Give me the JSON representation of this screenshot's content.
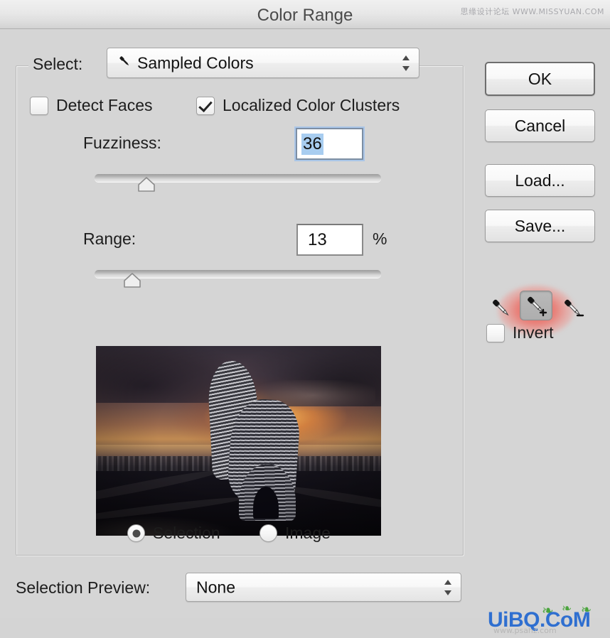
{
  "window": {
    "title": "Color Range"
  },
  "watermarks": {
    "top": "思缘设计论坛 WWW.MISSYUAN.COM",
    "bottom_logo": "UiBQ.CoM",
    "bottom_sub": "www.psahz.com"
  },
  "form": {
    "select_label": "Select:",
    "select_value": "Sampled Colors",
    "select_icon": "eyedropper-icon",
    "detect_faces": {
      "label": "Detect Faces",
      "checked": false
    },
    "localized_color_clusters": {
      "label": "Localized Color Clusters",
      "checked": true
    },
    "fuzziness": {
      "label": "Fuzziness:",
      "value": "36",
      "selected": true,
      "slider_percent": 18
    },
    "range": {
      "label": "Range:",
      "value": "13",
      "unit": "%",
      "slider_percent": 13
    },
    "preview_mode": {
      "selection_label": "Selection",
      "image_label": "Image",
      "selected": "Selection"
    },
    "selection_preview": {
      "label": "Selection Preview:",
      "value": "None"
    }
  },
  "buttons": {
    "ok": "OK",
    "cancel": "Cancel",
    "load": "Load...",
    "save": "Save..."
  },
  "tools": {
    "eyedropper": "eyedropper-icon",
    "eyedropper_add": "eyedropper-add-icon",
    "eyedropper_subtract": "eyedropper-subtract-icon",
    "active_tool": "eyedropper-add-icon"
  },
  "invert": {
    "label": "Invert",
    "checked": false
  },
  "colors": {
    "window_bg": "#d5d5d5",
    "titlebar_top": "#f0f0f0",
    "text": "#1d1d1d",
    "selection_highlight": "#a8cdf0",
    "focus_ring": "#aac6e8",
    "tool_glow": "#eb5a52",
    "logo_blue": "#2f6fd0"
  },
  "preview_image": {
    "description": "Dark sunset cityscape with curved modern tower"
  }
}
